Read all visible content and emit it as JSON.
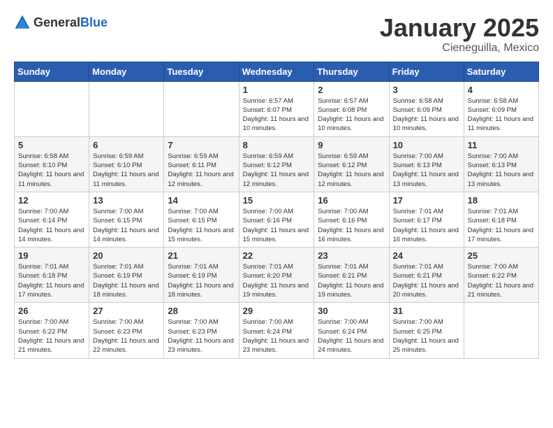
{
  "logo": {
    "general": "General",
    "blue": "Blue"
  },
  "header": {
    "month": "January 2025",
    "location": "Cieneguilla, Mexico"
  },
  "days_of_week": [
    "Sunday",
    "Monday",
    "Tuesday",
    "Wednesday",
    "Thursday",
    "Friday",
    "Saturday"
  ],
  "weeks": [
    [
      {
        "day": "",
        "info": ""
      },
      {
        "day": "",
        "info": ""
      },
      {
        "day": "",
        "info": ""
      },
      {
        "day": "1",
        "info": "Sunrise: 6:57 AM\nSunset: 6:07 PM\nDaylight: 11 hours and 10 minutes."
      },
      {
        "day": "2",
        "info": "Sunrise: 6:57 AM\nSunset: 6:08 PM\nDaylight: 11 hours and 10 minutes."
      },
      {
        "day": "3",
        "info": "Sunrise: 6:58 AM\nSunset: 6:09 PM\nDaylight: 11 hours and 10 minutes."
      },
      {
        "day": "4",
        "info": "Sunrise: 6:58 AM\nSunset: 6:09 PM\nDaylight: 11 hours and 11 minutes."
      }
    ],
    [
      {
        "day": "5",
        "info": "Sunrise: 6:58 AM\nSunset: 6:10 PM\nDaylight: 11 hours and 11 minutes."
      },
      {
        "day": "6",
        "info": "Sunrise: 6:59 AM\nSunset: 6:10 PM\nDaylight: 11 hours and 11 minutes."
      },
      {
        "day": "7",
        "info": "Sunrise: 6:59 AM\nSunset: 6:11 PM\nDaylight: 11 hours and 12 minutes."
      },
      {
        "day": "8",
        "info": "Sunrise: 6:59 AM\nSunset: 6:12 PM\nDaylight: 11 hours and 12 minutes."
      },
      {
        "day": "9",
        "info": "Sunrise: 6:59 AM\nSunset: 6:12 PM\nDaylight: 11 hours and 12 minutes."
      },
      {
        "day": "10",
        "info": "Sunrise: 7:00 AM\nSunset: 6:13 PM\nDaylight: 11 hours and 13 minutes."
      },
      {
        "day": "11",
        "info": "Sunrise: 7:00 AM\nSunset: 6:13 PM\nDaylight: 11 hours and 13 minutes."
      }
    ],
    [
      {
        "day": "12",
        "info": "Sunrise: 7:00 AM\nSunset: 6:14 PM\nDaylight: 11 hours and 14 minutes."
      },
      {
        "day": "13",
        "info": "Sunrise: 7:00 AM\nSunset: 6:15 PM\nDaylight: 11 hours and 14 minutes."
      },
      {
        "day": "14",
        "info": "Sunrise: 7:00 AM\nSunset: 6:15 PM\nDaylight: 11 hours and 15 minutes."
      },
      {
        "day": "15",
        "info": "Sunrise: 7:00 AM\nSunset: 6:16 PM\nDaylight: 11 hours and 15 minutes."
      },
      {
        "day": "16",
        "info": "Sunrise: 7:00 AM\nSunset: 6:16 PM\nDaylight: 11 hours and 16 minutes."
      },
      {
        "day": "17",
        "info": "Sunrise: 7:01 AM\nSunset: 6:17 PM\nDaylight: 11 hours and 16 minutes."
      },
      {
        "day": "18",
        "info": "Sunrise: 7:01 AM\nSunset: 6:18 PM\nDaylight: 11 hours and 17 minutes."
      }
    ],
    [
      {
        "day": "19",
        "info": "Sunrise: 7:01 AM\nSunset: 6:18 PM\nDaylight: 11 hours and 17 minutes."
      },
      {
        "day": "20",
        "info": "Sunrise: 7:01 AM\nSunset: 6:19 PM\nDaylight: 11 hours and 18 minutes."
      },
      {
        "day": "21",
        "info": "Sunrise: 7:01 AM\nSunset: 6:19 PM\nDaylight: 11 hours and 18 minutes."
      },
      {
        "day": "22",
        "info": "Sunrise: 7:01 AM\nSunset: 6:20 PM\nDaylight: 11 hours and 19 minutes."
      },
      {
        "day": "23",
        "info": "Sunrise: 7:01 AM\nSunset: 6:21 PM\nDaylight: 11 hours and 19 minutes."
      },
      {
        "day": "24",
        "info": "Sunrise: 7:01 AM\nSunset: 6:21 PM\nDaylight: 11 hours and 20 minutes."
      },
      {
        "day": "25",
        "info": "Sunrise: 7:00 AM\nSunset: 6:22 PM\nDaylight: 11 hours and 21 minutes."
      }
    ],
    [
      {
        "day": "26",
        "info": "Sunrise: 7:00 AM\nSunset: 6:22 PM\nDaylight: 11 hours and 21 minutes."
      },
      {
        "day": "27",
        "info": "Sunrise: 7:00 AM\nSunset: 6:23 PM\nDaylight: 11 hours and 22 minutes."
      },
      {
        "day": "28",
        "info": "Sunrise: 7:00 AM\nSunset: 6:23 PM\nDaylight: 11 hours and 23 minutes."
      },
      {
        "day": "29",
        "info": "Sunrise: 7:00 AM\nSunset: 6:24 PM\nDaylight: 11 hours and 23 minutes."
      },
      {
        "day": "30",
        "info": "Sunrise: 7:00 AM\nSunset: 6:24 PM\nDaylight: 11 hours and 24 minutes."
      },
      {
        "day": "31",
        "info": "Sunrise: 7:00 AM\nSunset: 6:25 PM\nDaylight: 11 hours and 25 minutes."
      },
      {
        "day": "",
        "info": ""
      }
    ]
  ]
}
